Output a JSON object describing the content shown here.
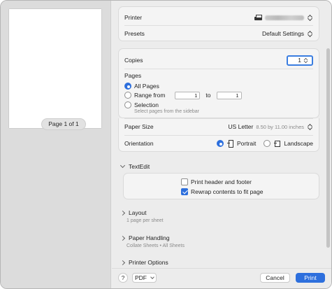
{
  "preview": {
    "page_indicator": "Page 1 of 1"
  },
  "printer": {
    "label": "Printer",
    "icon": "printer-icon"
  },
  "presets": {
    "label": "Presets",
    "value": "Default Settings"
  },
  "copies": {
    "label": "Copies",
    "value": "1"
  },
  "pages": {
    "label": "Pages",
    "all": "All Pages",
    "range": "Range from",
    "range_from": "1",
    "range_to_label": "to",
    "range_to": "1",
    "selection": "Selection",
    "selection_hint": "Select pages from the sidebar",
    "selected": "all"
  },
  "paper_size": {
    "label": "Paper Size",
    "value": "US Letter",
    "detail": "8.50 by 11.00 inches"
  },
  "orientation": {
    "label": "Orientation",
    "portrait": "Portrait",
    "landscape": "Landscape",
    "selected": "portrait"
  },
  "textedit": {
    "label": "TextEdit",
    "print_header": {
      "label": "Print header and footer",
      "checked": false
    },
    "rewrap": {
      "label": "Rewrap contents to fit page",
      "checked": true
    }
  },
  "layout": {
    "label": "Layout",
    "sub": "1 page per sheet"
  },
  "paper_handling": {
    "label": "Paper Handling",
    "sub": "Collate Sheets • All Sheets"
  },
  "printer_options": {
    "label": "Printer Options"
  },
  "footer": {
    "help": "?",
    "pdf": "PDF",
    "cancel": "Cancel",
    "print": "Print"
  },
  "colors": {
    "accent": "#2d6fdd"
  }
}
